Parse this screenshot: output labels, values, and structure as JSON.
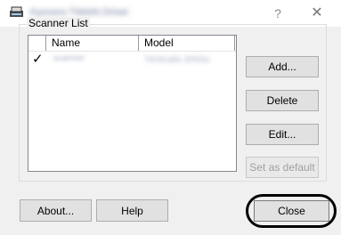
{
  "window": {
    "title": "Kyocera TWAIN Driver",
    "help_glyph": "?",
    "close_glyph": "✕"
  },
  "scanner_list": {
    "group_label": "Scanner List",
    "columns": {
      "name": "Name",
      "model": "Model"
    },
    "rows": [
      {
        "checked": true,
        "check_glyph": "✓",
        "name": "scanner",
        "model": "TASKalfa 3050ci"
      }
    ]
  },
  "side_buttons": {
    "add": "Add...",
    "delete": "Delete",
    "edit": "Edit...",
    "set_default": "Set as default"
  },
  "bottom_buttons": {
    "about": "About...",
    "help": "Help",
    "close": "Close"
  },
  "colors": {
    "dialog_bg": "#f0f0f0",
    "button_face": "#e1e1e1",
    "button_border": "#adadad",
    "highlight_ring": "#000000"
  }
}
